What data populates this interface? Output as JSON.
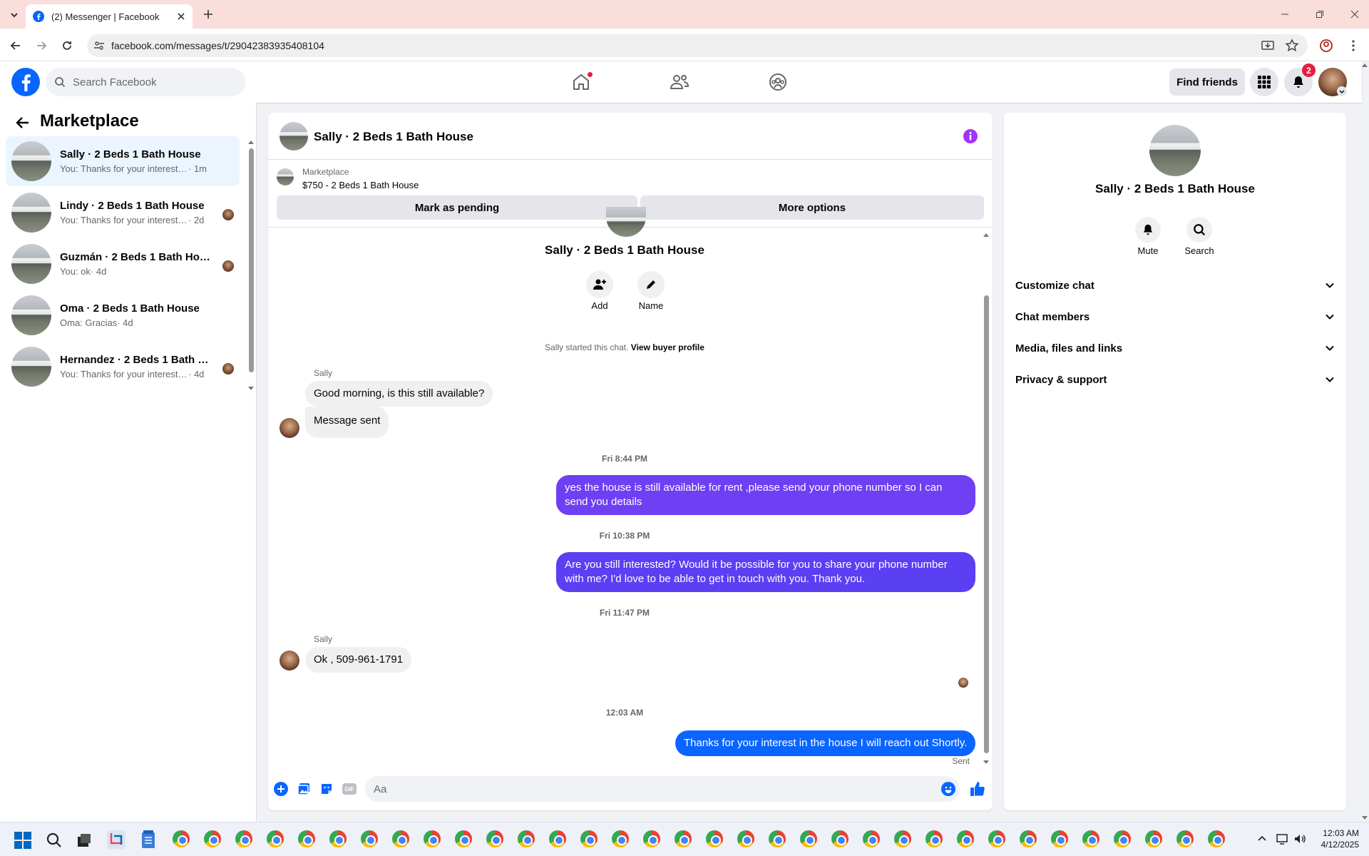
{
  "browser": {
    "tab_title": "(2) Messenger | Facebook",
    "url": "facebook.com/messages/t/29042383935408104"
  },
  "fb_header": {
    "search_placeholder": "Search Facebook",
    "find_friends": "Find friends",
    "notification_count": "2",
    "accent_color": "#0866ff"
  },
  "left_panel": {
    "title": "Marketplace",
    "conversations": [
      {
        "name": "Sally · 2 Beds 1 Bath House",
        "preview": "You: Thanks for your interest in the...",
        "time": "· 1m",
        "active": true
      },
      {
        "name": "Lindy · 2 Beds 1 Bath House",
        "preview": "You: Thanks for your interest in t...",
        "time": "· 2d"
      },
      {
        "name": "Guzmán · 2 Beds 1 Bath House",
        "preview": "You: ok",
        "time": "· 4d"
      },
      {
        "name": "Oma · 2 Beds 1 Bath House",
        "preview": "Oma: Gracias",
        "time": "· 4d"
      },
      {
        "name": "Hernandez · 2 Beds 1 Bath Ho...",
        "preview": "You: Thanks for your interest in t...",
        "time": "· 4d"
      }
    ]
  },
  "chat": {
    "title": "Sally · 2 Beds 1 Bath House",
    "listing_source": "Marketplace",
    "listing_title": "$750 - 2 Beds 1 Bath House",
    "mark_pending": "Mark as pending",
    "more_options": "More options",
    "profile_name": "Sally · 2 Beds 1 Bath House",
    "add_label": "Add",
    "name_label": "Name",
    "started_text": "Sally started this chat.",
    "view_profile": "View buyer profile",
    "sender_1": "Sally",
    "msg_1": "Good morning, is this still available?",
    "msg_2": "Message sent",
    "ts_1": "Fri 8:44 PM",
    "msg_3": "yes the house is still available for rent ,please send your phone number so I can send you details",
    "ts_2": "Fri 10:38 PM",
    "msg_4": "Are you still interested? Would it be possible for you to share your phone number with me? I'd love to be able to get in touch with you.  Thank you.",
    "ts_3": "Fri 11:47 PM",
    "sender_2": "Sally",
    "msg_5": "Ok , 509-961-1791",
    "ts_4": "12:03 AM",
    "msg_6": "Thanks for your interest in the house I will reach out Shortly.",
    "sent_status": "Sent",
    "composer_placeholder": "Aa",
    "outgoing_color": "#5b3ff2"
  },
  "right_panel": {
    "name": "Sally · 2 Beds 1 Bath House",
    "mute": "Mute",
    "search": "Search",
    "sections": [
      "Customize chat",
      "Chat members",
      "Media, files and links",
      "Privacy & support"
    ]
  },
  "taskbar": {
    "time": "12:03 AM",
    "date": "4/12/2025"
  }
}
